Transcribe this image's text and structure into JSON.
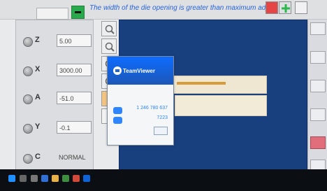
{
  "topbar": {
    "message": "The width of the die opening is greater than maximum adju",
    "field_value": ""
  },
  "axes": [
    {
      "label": "Z",
      "value": "5.00"
    },
    {
      "label": "X",
      "value": "3000.00"
    },
    {
      "label": "A",
      "value": "-51.0"
    },
    {
      "label": "Y",
      "value": "-0.1"
    },
    {
      "label": "C",
      "value": "NORMAL"
    }
  ],
  "teamviewer": {
    "title": "TeamViewer",
    "subtitle": "",
    "id_value": "1 246 780 637",
    "password_value": "7223",
    "button_label": "",
    "small_lines": []
  },
  "taskbar": {
    "time": "",
    "date": ""
  },
  "colors": {
    "workspace_blue": "#18407f",
    "blade_orange": "#d79b3a",
    "teamviewer_blue": "#1d57b6"
  }
}
